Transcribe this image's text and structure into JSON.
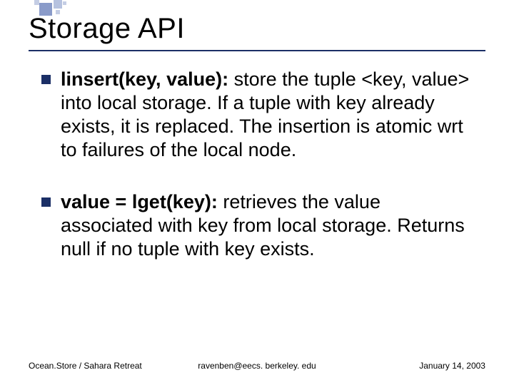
{
  "title": "Storage API",
  "bullets": [
    {
      "lead": "linsert(key, value):",
      "rest": " store the tuple <key, value> into local storage. If a tuple with key already exists, it is replaced. The insertion is atomic wrt to failures of the local node."
    },
    {
      "lead": "value = lget(key):",
      "rest": " retrieves the value associated with key from local storage. Returns null if no tuple with key exists."
    }
  ],
  "footer": {
    "left": "Ocean.Store / Sahara Retreat",
    "center": "ravenben@eecs. berkeley. edu",
    "right": "January 14, 2003"
  }
}
